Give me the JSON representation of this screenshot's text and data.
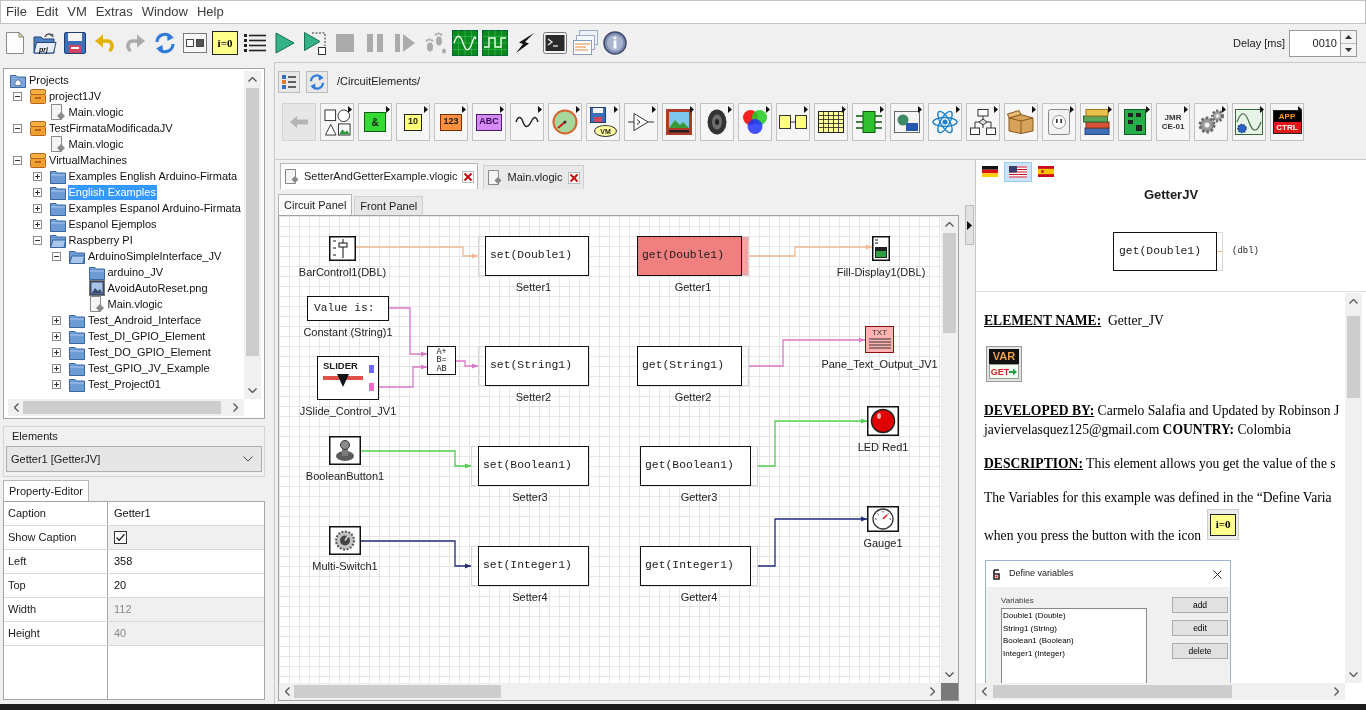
{
  "menu": [
    {
      "label": "File"
    },
    {
      "label": "Edit"
    },
    {
      "label": "VM"
    },
    {
      "label": "Extras"
    },
    {
      "label": "Window"
    },
    {
      "label": "Help"
    }
  ],
  "toolbar": [
    {
      "kind": "new",
      "disabled": false
    },
    {
      "kind": "open_project",
      "label": "prj",
      "disabled": false
    },
    {
      "kind": "save",
      "disabled": false
    },
    {
      "kind": "undo",
      "disabled": false
    },
    {
      "kind": "redo",
      "disabled": true
    },
    {
      "kind": "refresh",
      "disabled": false
    },
    {
      "kind": "panels",
      "disabled": false
    },
    {
      "kind": "variables",
      "label": "i=0",
      "disabled": false
    },
    {
      "kind": "list",
      "disabled": false
    },
    {
      "kind": "run",
      "disabled": false
    },
    {
      "kind": "debug",
      "disabled": false
    },
    {
      "kind": "stop",
      "disabled": true
    },
    {
      "kind": "pause",
      "disabled": true
    },
    {
      "kind": "step",
      "disabled": true
    },
    {
      "kind": "trace",
      "disabled": true
    },
    {
      "kind": "scope_sine",
      "disabled": false
    },
    {
      "kind": "scope_square",
      "disabled": false
    },
    {
      "kind": "bolt",
      "disabled": false
    },
    {
      "kind": "console",
      "disabled": false
    },
    {
      "kind": "windows",
      "disabled": false
    },
    {
      "kind": "info",
      "disabled": false
    }
  ],
  "delay": {
    "label": "Delay [ms]",
    "value": "0010"
  },
  "tree": [
    {
      "label": "Projects",
      "kind": "root",
      "selected": false,
      "children": [
        {
          "label": "project1JV",
          "kind": "project",
          "expanded": true,
          "selected": false,
          "children": [
            {
              "label": "Main.vlogic",
              "kind": "file",
              "selected": false
            }
          ]
        },
        {
          "label": "TestFirmataModificadaJV",
          "kind": "project",
          "expanded": true,
          "selected": false,
          "children": [
            {
              "label": "Main.vlogic",
              "kind": "file",
              "selected": false
            }
          ]
        },
        {
          "label": "VirtualMachines",
          "kind": "project",
          "expanded": true,
          "selected": false,
          "children": [
            {
              "label": "Examples English Arduino-Firmata",
              "kind": "folder",
              "expanded": false,
              "selected": false
            },
            {
              "label": "English Examples",
              "kind": "folder",
              "expanded": false,
              "selected": true
            },
            {
              "label": "Examples Espanol Arduino-Firmata",
              "kind": "folder",
              "expanded": false,
              "selected": false
            },
            {
              "label": "Espanol Ejemplos",
              "kind": "folder",
              "expanded": false,
              "selected": false
            },
            {
              "label": "Raspberry PI",
              "kind": "folder",
              "expanded": true,
              "selected": false,
              "children": [
                {
                  "label": "ArduinoSimpleInterface_JV",
                  "kind": "folder",
                  "expanded": true,
                  "selected": false,
                  "children": [
                    {
                      "label": "arduino_JV",
                      "kind": "folder",
                      "selected": false
                    },
                    {
                      "label": "AvoidAutoReset.png",
                      "kind": "image",
                      "selected": false
                    },
                    {
                      "label": "Main.vlogic",
                      "kind": "file",
                      "selected": false
                    }
                  ]
                },
                {
                  "label": "Test_Android_Interface",
                  "kind": "folder",
                  "expanded": false,
                  "selected": false
                },
                {
                  "label": "Test_DI_GPIO_Element",
                  "kind": "folder",
                  "expanded": false,
                  "selected": false
                },
                {
                  "label": "Test_DO_GPIO_Element",
                  "kind": "folder",
                  "expanded": false,
                  "selected": false
                },
                {
                  "label": "Test_GPIO_JV_Example",
                  "kind": "folder",
                  "expanded": false,
                  "selected": false
                },
                {
                  "label": "Test_Project01",
                  "kind": "folder",
                  "expanded": false,
                  "selected": false
                }
              ]
            }
          ]
        }
      ]
    }
  ],
  "elements": {
    "label": "Elements",
    "value": "Getter1 [GetterJV]"
  },
  "property_editor": {
    "tab": "Property-Editor",
    "rows": [
      {
        "name": "Caption",
        "kind": "text",
        "value": "Getter1",
        "disabled": false
      },
      {
        "name": "Show Caption",
        "kind": "checkbox",
        "checked": true
      },
      {
        "name": "Left",
        "kind": "text",
        "value": "358",
        "disabled": false
      },
      {
        "name": "Top",
        "kind": "text",
        "value": "20",
        "disabled": false
      },
      {
        "name": "Width",
        "kind": "text",
        "value": "112",
        "disabled": true
      },
      {
        "name": "Height",
        "kind": "text",
        "value": "40",
        "disabled": true
      }
    ]
  },
  "element_browser": {
    "path": "/CircuitElements/",
    "palette": [
      {
        "kind": "back",
        "disabled": true
      },
      {
        "kind": "shapes",
        "disabled": false
      },
      {
        "kind": "logic",
        "label": "&",
        "disabled": false
      },
      {
        "kind": "number_display",
        "label": "10",
        "disabled": false
      },
      {
        "kind": "number",
        "label": "123",
        "disabled": false
      },
      {
        "kind": "string",
        "label": "ABC",
        "disabled": false
      },
      {
        "kind": "wave",
        "disabled": false
      },
      {
        "kind": "gauge",
        "disabled": false
      },
      {
        "kind": "vm",
        "label": "VM",
        "disabled": false
      },
      {
        "kind": "amplifier",
        "disabled": false
      },
      {
        "kind": "picture",
        "disabled": false
      },
      {
        "kind": "speaker",
        "disabled": false
      },
      {
        "kind": "rgb",
        "disabled": false
      },
      {
        "kind": "pair",
        "disabled": false
      },
      {
        "kind": "table",
        "disabled": false
      },
      {
        "kind": "chip",
        "disabled": false
      },
      {
        "kind": "image",
        "disabled": false
      },
      {
        "kind": "atom",
        "disabled": false
      },
      {
        "kind": "flowchart",
        "disabled": false
      },
      {
        "kind": "box",
        "disabled": false
      },
      {
        "kind": "outlet",
        "disabled": false
      },
      {
        "kind": "books",
        "disabled": false
      },
      {
        "kind": "board",
        "disabled": false
      },
      {
        "kind": "jmr",
        "lines": [
          "JMR",
          "CE-01"
        ],
        "disabled": false
      },
      {
        "kind": "gears",
        "disabled": false
      },
      {
        "kind": "scope_gear",
        "disabled": false
      },
      {
        "kind": "app",
        "lines": [
          "APP",
          "CTRL"
        ],
        "disabled": false
      }
    ]
  },
  "document_tabs": [
    {
      "label": "SetterAndGetterExample.vlogic",
      "selected": true
    },
    {
      "label": "Main.vlogic",
      "selected": false
    }
  ],
  "panel_tabs": [
    {
      "label": "Circuit Panel",
      "selected": true
    },
    {
      "label": "Front Panel",
      "selected": false
    }
  ],
  "canvas": {
    "nodes": [
      {
        "kind": "bar_control",
        "caption": "BarControl1(DBL)",
        "selected": false
      },
      {
        "kind": "setter",
        "text": "set(Double1)",
        "caption": "Setter1",
        "selected": false
      },
      {
        "kind": "getter",
        "text": "get(Double1)",
        "caption": "Getter1",
        "selected": true
      },
      {
        "kind": "fill_display",
        "caption": "Fill-Display1(DBL)",
        "selected": false
      },
      {
        "kind": "constant",
        "text": "Value is:",
        "caption": "Constant (String)1",
        "selected": false
      },
      {
        "kind": "slider",
        "text": "SLIDER",
        "caption": "JSlide_Control_JV1",
        "selected": false
      },
      {
        "kind": "concat",
        "lines": [
          "A+",
          "B=",
          "AB"
        ],
        "selected": false
      },
      {
        "kind": "setter",
        "text": "set(String1)",
        "caption": "Setter2",
        "selected": false
      },
      {
        "kind": "getter",
        "text": "get(String1)",
        "caption": "Getter2",
        "selected": false
      },
      {
        "kind": "text_output",
        "text": "TXT",
        "caption": "Pane_Text_Output_JV1",
        "selected": false
      },
      {
        "kind": "boolean_button",
        "caption": "BooleanButton1",
        "selected": false
      },
      {
        "kind": "setter",
        "text": "set(Boolean1)",
        "caption": "Setter3",
        "selected": false
      },
      {
        "kind": "getter",
        "text": "get(Boolean1)",
        "caption": "Getter3",
        "selected": false
      },
      {
        "kind": "led",
        "caption": "LED Red1",
        "selected": false
      },
      {
        "kind": "multi_switch",
        "caption": "Multi-Switch1",
        "selected": false
      },
      {
        "kind": "setter",
        "text": "set(Integer1)",
        "caption": "Setter4",
        "selected": false
      },
      {
        "kind": "getter",
        "text": "get(Integer1)",
        "caption": "Getter4",
        "selected": false
      },
      {
        "kind": "gauge",
        "caption": "Gauge1",
        "selected": false
      }
    ]
  },
  "help": {
    "languages": [
      {
        "kind": "de",
        "selected": false
      },
      {
        "kind": "us",
        "selected": true
      },
      {
        "kind": "es",
        "selected": false
      }
    ],
    "title": "GetterJV",
    "preview": {
      "text": "get(Double1)",
      "port": "(dbl)"
    },
    "element_name": "**ELEMENT NAME:**  Getter_JV",
    "badge": {
      "top": "VAR",
      "bottom": "GET"
    },
    "developed_by": "**DEVELOPED BY:** Carmelo Salafia and Updated by Robinson J",
    "contact": "javiervelasquez125@gmail.com **COUNTRY:** Colombia",
    "description": "**DESCRIPTION:** This element allows you get the value of the s",
    "variables_note": "The Variables for this example was defined in the “Define Varia",
    "button_note": {
      "text": "when you press the button with the icon",
      "icon_label": "i=0"
    },
    "dialog": {
      "title": "Define variables",
      "group": "Variables",
      "items": [
        "Double1 (Double)",
        "String1 (String)",
        "Boolean1 (Boolean)",
        "Integer1 (Integer)"
      ],
      "buttons": [
        "add",
        "edit",
        "delete"
      ]
    }
  }
}
